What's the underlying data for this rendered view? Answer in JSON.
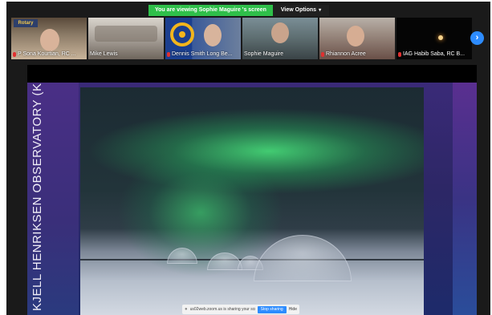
{
  "banner": {
    "viewing_text": "You are viewing Sophie Maguire 's screen",
    "view_options_label": "View Options"
  },
  "participants": [
    {
      "name": "P Sona Kourtian, RC ...",
      "muted": true,
      "badge": "Rotary"
    },
    {
      "name": "Mike Lewis",
      "muted": false
    },
    {
      "name": "Dennis Smith Long Be...",
      "muted": true
    },
    {
      "name": "Sophie Maguire",
      "muted": false
    },
    {
      "name": "Rhiannon Acree",
      "muted": true
    },
    {
      "name": "IAG Habib Saba, RC B...",
      "muted": true
    }
  ],
  "slide": {
    "title": "KJELL HENRIKSEN OBSERVATORY (KHO)"
  },
  "share_bar": {
    "message": "us02web.zoom.us is sharing your screen.",
    "stop_label": "Stop sharing",
    "hide_label": "Hide"
  },
  "icons": {
    "next": "chevron-right-icon",
    "mic": "mic-muted-icon"
  },
  "colors": {
    "banner_green": "#2fbf4a",
    "accent_blue": "#2d8cff",
    "mute_red": "#e03030"
  }
}
